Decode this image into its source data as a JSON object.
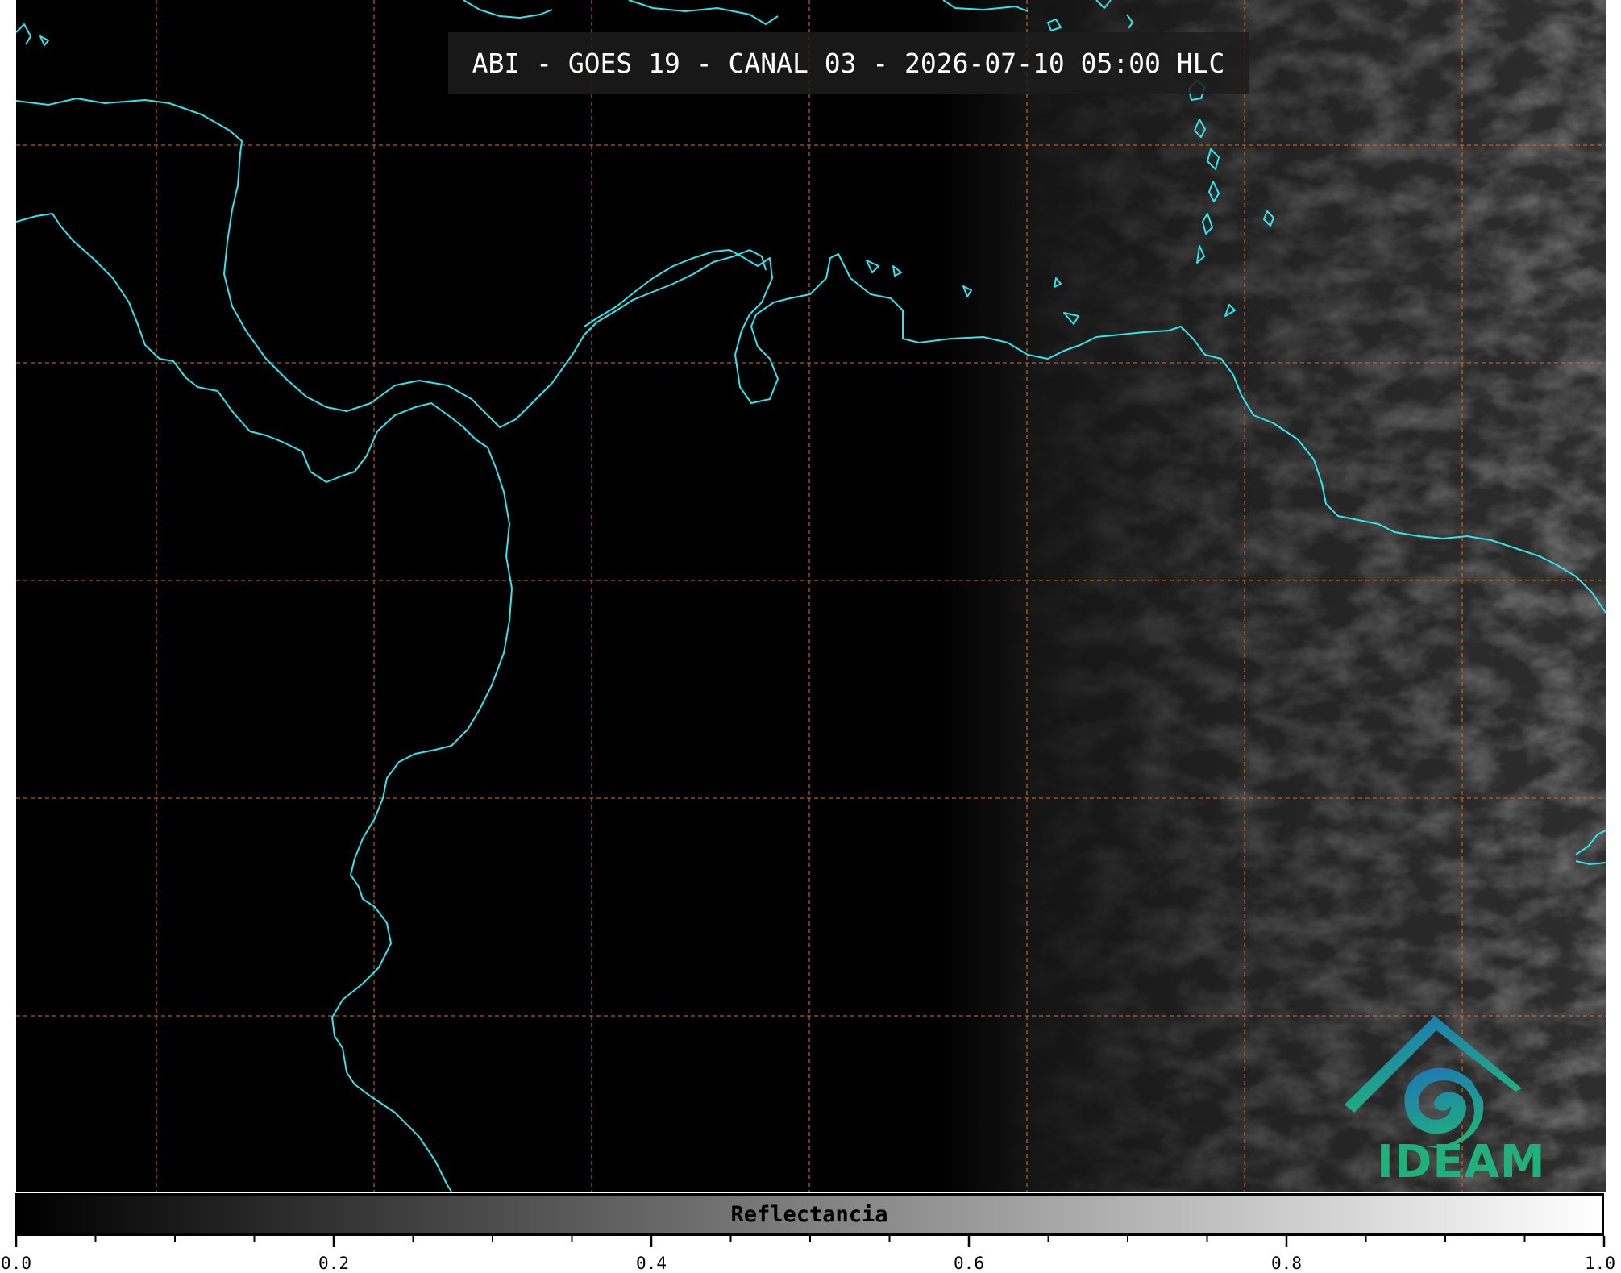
{
  "title": "ABI - GOES 19 - CANAL 03 - 2026-07-10 05:00 HLC",
  "logo": {
    "text": "IDEAM"
  },
  "colorbar": {
    "label": "Reflectancia",
    "range": [
      0.0,
      1.0
    ],
    "colormap": "grayscale black-to-white",
    "ticks": [
      {
        "value": 0.0,
        "label": "0.0"
      },
      {
        "value": 0.2,
        "label": "0.2"
      },
      {
        "value": 0.4,
        "label": "0.4"
      },
      {
        "value": 0.6,
        "label": "0.6"
      },
      {
        "value": 0.8,
        "label": "0.8"
      },
      {
        "value": 1.0,
        "label": "1.0"
      }
    ],
    "minor_tick_step": 0.05
  },
  "colors": {
    "coastline": "#2fe6ee",
    "gridline": "#d2691e",
    "background": "#000000",
    "title_box": "#1c1c1c",
    "logo_blue": "#1e74b8",
    "logo_green": "#1fb07e"
  },
  "map": {
    "gridlines": "dashed",
    "imagery": "visible channel, dark night side to the west, faint cloud reflectance to the east"
  }
}
